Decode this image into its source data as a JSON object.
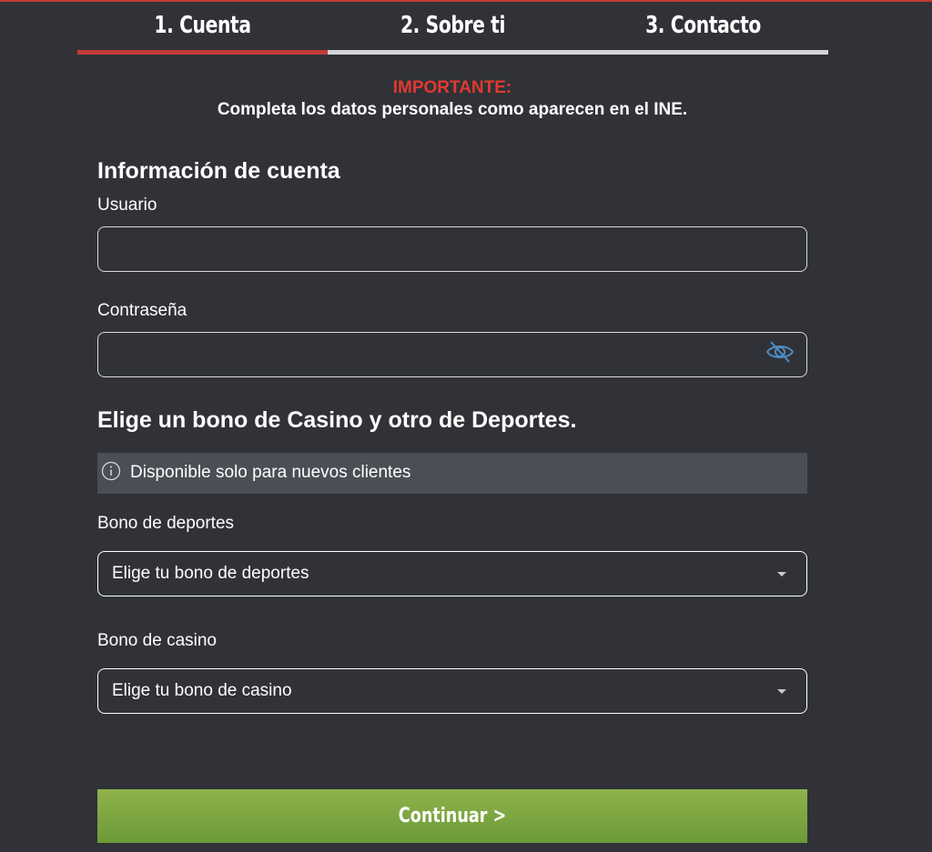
{
  "colors": {
    "background": "#303237",
    "accent_red": "#c23b38",
    "step_inactive": "#d4d4d4",
    "important_red": "#e2392f",
    "info_bg": "#4b4e55",
    "button_green": "#7ea543",
    "eye_blue": "#4d8cc4"
  },
  "steps": [
    {
      "label": "1. Cuenta",
      "active": true
    },
    {
      "label": "2. Sobre ti",
      "active": false
    },
    {
      "label": "3. Contacto",
      "active": false
    }
  ],
  "notice": {
    "title": "IMPORTANTE:",
    "text": "Completa los datos personales como aparecen en el INE."
  },
  "account": {
    "title": "Información de cuenta",
    "username": {
      "label": "Usuario",
      "value": "",
      "placeholder": ""
    },
    "password": {
      "label": "Contraseña",
      "value": "",
      "placeholder": "",
      "toggle_icon": "eye-slash-icon"
    }
  },
  "bonus": {
    "title": "Elige un bono de Casino y otro de Deportes.",
    "info": {
      "icon": "info-icon",
      "text": "Disponible solo para nuevos clientes"
    },
    "sports": {
      "label": "Bono de deportes",
      "selected": "Elige tu bono de deportes"
    },
    "casino": {
      "label": "Bono de casino",
      "selected": "Elige tu bono de casino"
    }
  },
  "actions": {
    "continue_label": "Continuar >"
  }
}
